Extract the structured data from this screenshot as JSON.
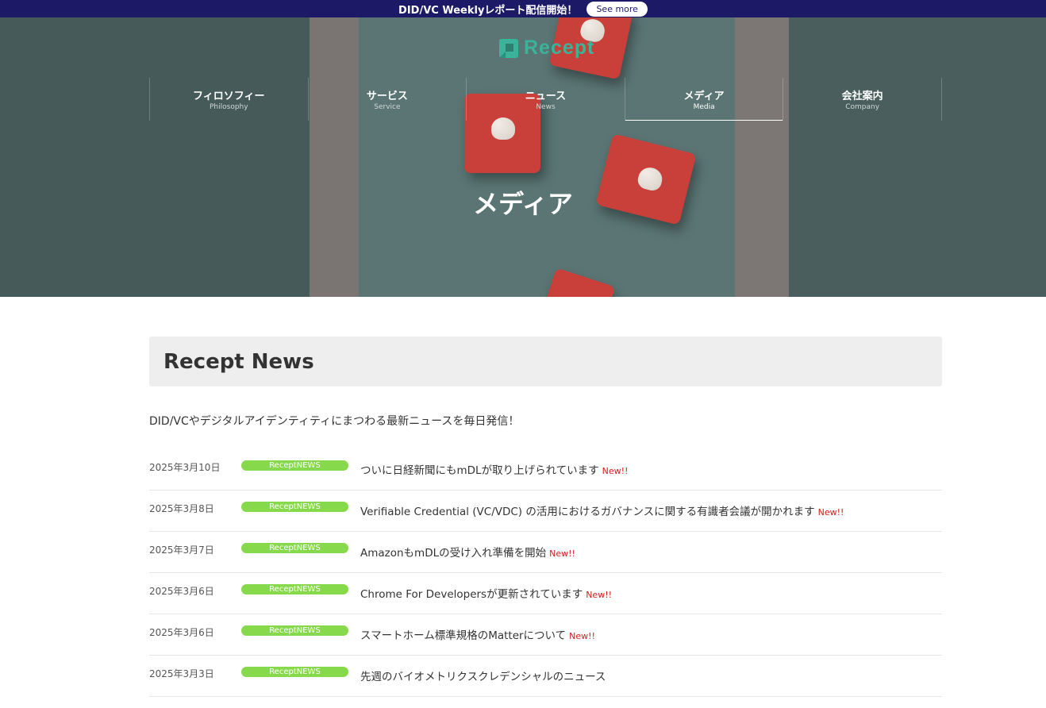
{
  "topbar": {
    "text": "DID/VC Weeklyレポート配信開始！",
    "button": "See more"
  },
  "logo": {
    "name": "Recept"
  },
  "nav": [
    {
      "jp": "フィロソフィー",
      "en": "Philosophy"
    },
    {
      "jp": "サービス",
      "en": "Service"
    },
    {
      "jp": "ニュース",
      "en": "News"
    },
    {
      "jp": "メディア",
      "en": "Media"
    },
    {
      "jp": "会社案内",
      "en": "Company"
    }
  ],
  "hero": {
    "title": "メディア"
  },
  "section": {
    "title": "Recept News",
    "intro": "DID/VCやデジタルアイデンティティにまつわる最新ニュースを毎日発信！"
  },
  "news": [
    {
      "date": "2025年3月10日",
      "tag": "ReceptNEWS",
      "title": "ついに日経新聞にもmDLが取り上げられています",
      "badge": "New!!"
    },
    {
      "date": "2025年3月8日",
      "tag": "ReceptNEWS",
      "title": "Verifiable Credential (VC/VDC) の活用におけるガバナンスに関する有識者会議が開かれます",
      "badge": "New!!"
    },
    {
      "date": "2025年3月7日",
      "tag": "ReceptNEWS",
      "title": "AmazonもmDLの受け入れ準備を開始",
      "badge": "New!!"
    },
    {
      "date": "2025年3月6日",
      "tag": "ReceptNEWS",
      "title": "Chrome For Developersが更新されています",
      "badge": "New!!"
    },
    {
      "date": "2025年3月6日",
      "tag": "ReceptNEWS",
      "title": "スマートホーム標準規格のMatterについて",
      "badge": "New!!"
    },
    {
      "date": "2025年3月3日",
      "tag": "ReceptNEWS",
      "title": "先週のバイオメトリクスクレデンシャルのニュース",
      "badge": ""
    }
  ],
  "colors": {
    "topbar": "#1c1a66",
    "tag": "#86d94a",
    "new_badge": "#d21d1d",
    "logo": "#3ab39a"
  }
}
